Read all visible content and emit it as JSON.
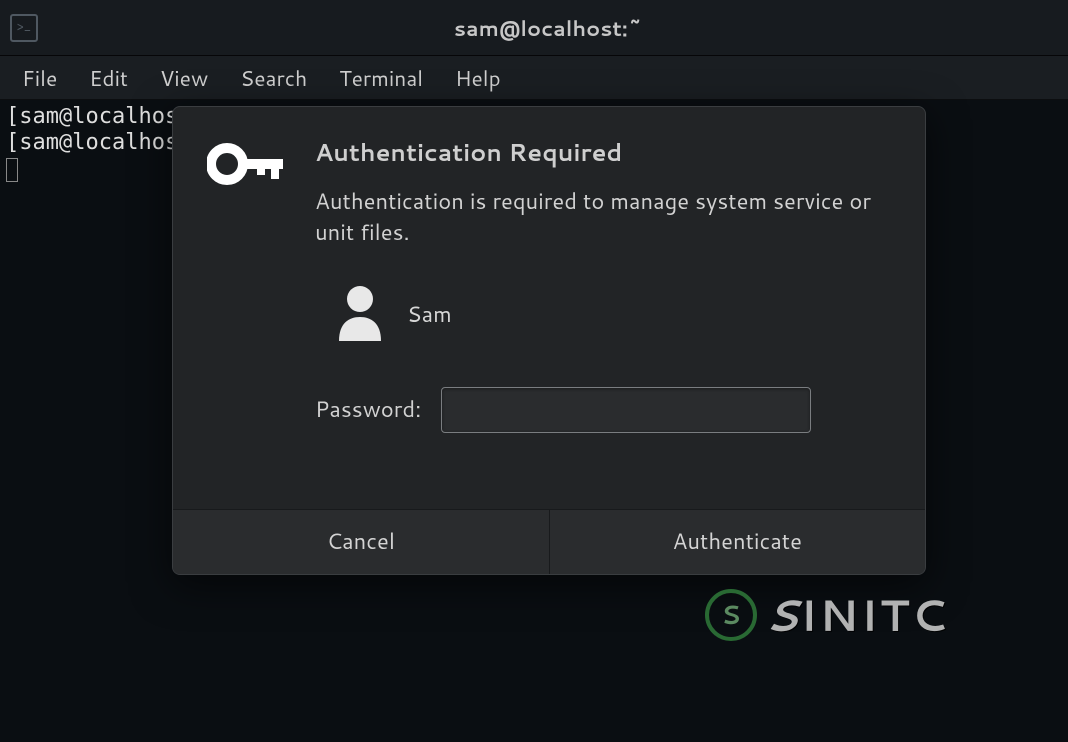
{
  "window": {
    "title": "sam@localhost:~"
  },
  "menubar": {
    "file": "File",
    "edit": "Edit",
    "view": "View",
    "search": "Search",
    "terminal": "Terminal",
    "help": "Help"
  },
  "terminal": {
    "line1": "[sam@localhos",
    "line2": "[sam@localhos"
  },
  "dialog": {
    "title": "Authentication Required",
    "message": "Authentication is required to manage system service or unit files.",
    "user_name": "Sam",
    "password_label": "Password:",
    "password_value": "",
    "cancel_label": "Cancel",
    "auth_label": "Authenticate"
  },
  "watermark": {
    "symbol": "S",
    "text_head": "S",
    "text_rest": "INITC"
  }
}
